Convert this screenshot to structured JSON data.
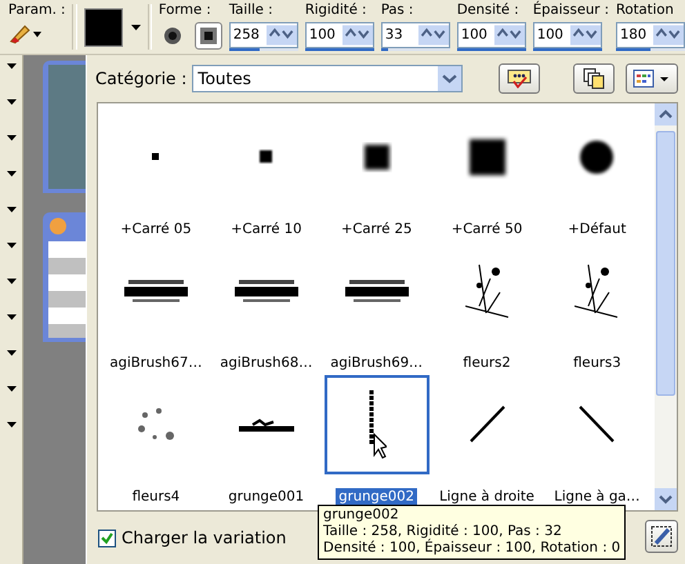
{
  "toolbar": {
    "preset_label": "Param. :",
    "shape_label": "Forme :",
    "shapes": [
      {
        "kind": "round",
        "selected": false
      },
      {
        "kind": "square",
        "selected": true
      }
    ],
    "fields": [
      {
        "label": "Taille :",
        "value": "258",
        "level": 0.45
      },
      {
        "label": "Rigidité :",
        "value": "100",
        "level": 1
      },
      {
        "label": "Pas :",
        "value": "33",
        "level": 0.1
      },
      {
        "label": "Densité :",
        "value": "100",
        "level": 1
      },
      {
        "label": "Épaisseur :",
        "value": "100",
        "level": 1
      },
      {
        "label": "Rotation",
        "value": "180",
        "level": 0.5
      }
    ]
  },
  "picker": {
    "category_label": "Catégorie :",
    "category_value": "Toutes",
    "brushes": [
      {
        "name": "+Carré 05",
        "kind": "dot-small",
        "selected": false
      },
      {
        "name": "+Carré 10",
        "kind": "dot-medium",
        "selected": false
      },
      {
        "name": "+Carré 25",
        "kind": "square-soft",
        "selected": false
      },
      {
        "name": "+Carré 50",
        "kind": "square-large",
        "selected": false
      },
      {
        "name": "+Défaut",
        "kind": "circle",
        "selected": false
      },
      {
        "name": "agiBrush67…",
        "kind": "text-brush",
        "selected": false
      },
      {
        "name": "agiBrush68…",
        "kind": "text-brush",
        "selected": false
      },
      {
        "name": "agiBrush69…",
        "kind": "text-brush",
        "selected": false
      },
      {
        "name": "fleurs2",
        "kind": "flower",
        "selected": false
      },
      {
        "name": "fleurs3",
        "kind": "flower",
        "selected": false
      },
      {
        "name": "fleurs4",
        "kind": "speckle",
        "selected": false
      },
      {
        "name": "grunge001",
        "kind": "grunge",
        "selected": false
      },
      {
        "name": "grunge002",
        "kind": "grunge-vertical",
        "selected": true
      },
      {
        "name": "Ligne à droite",
        "kind": "line-right",
        "selected": false
      },
      {
        "name": "Ligne à ga…",
        "kind": "line-left",
        "selected": false
      }
    ],
    "load_variation": {
      "label": "Charger la variation",
      "checked": true
    },
    "tooltip": [
      "grunge002",
      "Taille : 258, Rigidité : 100, Pas : 32",
      "Densité : 100, Épaisseur : 100, Rotation : 0"
    ]
  }
}
